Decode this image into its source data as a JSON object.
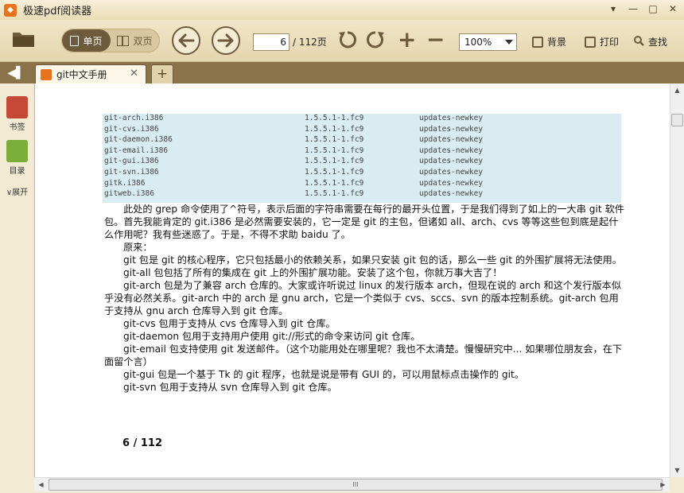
{
  "window": {
    "title": "极速pdf阅读器",
    "app_icon": "pdf-app-icon",
    "controls": [
      "menu-icon",
      "minimize-icon",
      "maximize-icon",
      "close-icon"
    ]
  },
  "toolbar": {
    "open_icon": "folder-icon",
    "single_page_label": "单页",
    "double_page_label": "双页",
    "prev_icon": "arrow-left-icon",
    "next_icon": "arrow-right-icon",
    "current_page": "6",
    "total_pages_label": "/ 112页",
    "rotate_ccw_icon": "rotate-ccw-icon",
    "rotate_cw_icon": "rotate-cw-icon",
    "zoom_in_icon": "plus-icon",
    "zoom_out_icon": "minus-icon",
    "zoom_value": "100%",
    "background_label": "背景",
    "print_label": "打印",
    "find_label": "查找"
  },
  "tabs": {
    "active_tab_label": "git中文手册",
    "new_tab_label": "+"
  },
  "sidebar": {
    "bookmark_label": "书签",
    "outline_label": "目录",
    "expand_label": "展开"
  },
  "document": {
    "package_rows": [
      {
        "name": "git-arch.i386",
        "version": "1.5.5.1-1.fc9",
        "repo": "updates-newkey"
      },
      {
        "name": "git-cvs.i386",
        "version": "1.5.5.1-1.fc9",
        "repo": "updates-newkey"
      },
      {
        "name": "git-daemon.i386",
        "version": "1.5.5.1-1.fc9",
        "repo": "updates-newkey"
      },
      {
        "name": "git-email.i386",
        "version": "1.5.5.1-1.fc9",
        "repo": "updates-newkey"
      },
      {
        "name": "git-gui.i386",
        "version": "1.5.5.1-1.fc9",
        "repo": "updates-newkey"
      },
      {
        "name": "git-svn.i386",
        "version": "1.5.5.1-1.fc9",
        "repo": "updates-newkey"
      },
      {
        "name": "gitk.i386",
        "version": "1.5.5.1-1.fc9",
        "repo": "updates-newkey"
      },
      {
        "name": "gitweb.i386",
        "version": "1.5.5.1-1.fc9",
        "repo": "updates-newkey"
      }
    ],
    "paragraphs": [
      "此处的 grep 命令使用了^符号，表示后面的字符串需要在每行的最开头位置，于是我们得到了如上的一大串 git 软件包。首先我能肯定的 git.i386 是必然需要安装的，它一定是 git 的主包，但诸如 all、arch、cvs 等等这些包到底是起什么作用呢？我有些迷惑了。于是，不得不求助 baidu 了。",
      "原来：",
      "git 包是 git 的核心程序，它只包括最小的依赖关系，如果只安装 git 包的话，那么一些 git 的外围扩展将无法使用。",
      "git-all 包包括了所有的集成在 git 上的外围扩展功能。安装了这个包，你就万事大吉了！",
      "git-arch 包是为了兼容 arch 仓库的。大家或许听说过 linux 的发行版本 arch，但现在说的 arch 和这个发行版本似乎没有必然关系。git-arch 中的 arch 是 gnu arch，它是一个类似于 cvs、sccs、svn 的版本控制系统。git-arch 包用于支持从 gnu arch 仓库导入到 git 仓库。",
      "git-cvs 包用于支持从 cvs 仓库导入到 git 仓库。",
      "git-daemon 包用于支持用户使用 git://形式的命令来访问 git 仓库。",
      "git-email 包支持使用 git 发送邮件。（这个功能用处在哪里呢？我也不太清楚。慢慢研究中... 如果哪位朋友会，在下面留个言）",
      "git-gui 包是一个基于 Tk 的 git 程序，也就是说是带有 GUI 的，可以用鼠标点击操作的 git。",
      "git-svn 包用于支持从 svn 仓库导入到 git 仓库。"
    ],
    "page_number": "6",
    "page_separator": "/",
    "page_total": "112"
  },
  "scrollbars": {
    "up_icon": "scroll-up-icon",
    "down_icon": "scroll-down-icon",
    "left_icon": "scroll-left-icon",
    "right_icon": "scroll-right-icon",
    "thumb_grip": "III"
  },
  "colors": {
    "accent": "#6e5a3c",
    "brand_orange": "#e8731c",
    "tabbar": "#8a7349",
    "code_bg": "#d9ecf1",
    "bookmark_red": "#c44a37",
    "outline_green": "#7bad3b"
  }
}
